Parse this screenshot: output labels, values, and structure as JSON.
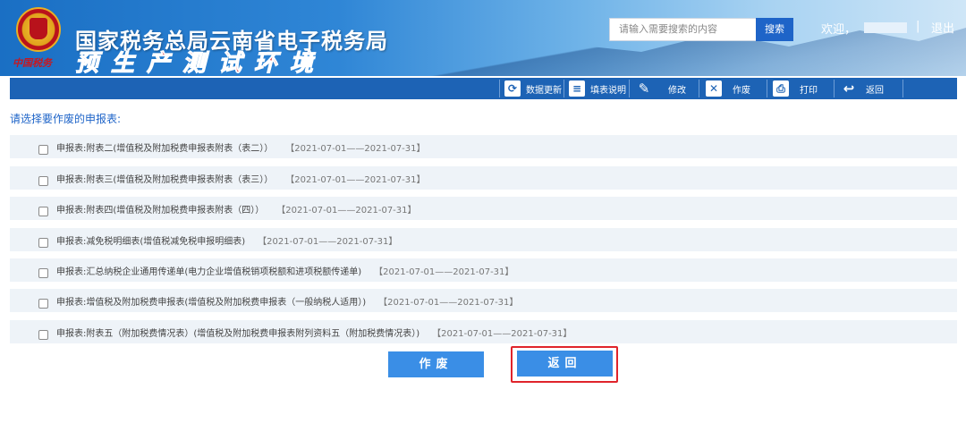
{
  "header": {
    "title": "国家税务总局云南省电子税务局",
    "env_title": "预生产测试环境",
    "emblem_caption": "中国税务",
    "search_placeholder": "请输入需要搜索的内容",
    "search_label": "搜索",
    "welcome": "欢迎，",
    "separator": "|",
    "logout": "退出"
  },
  "toolbar": {
    "items": [
      {
        "label": "数据更新",
        "icon": "data-refresh-icon"
      },
      {
        "label": "填表说明",
        "icon": "instructions-icon"
      },
      {
        "label": "修改",
        "icon": "edit-icon"
      },
      {
        "label": "作废",
        "icon": "void-document-icon"
      },
      {
        "label": "打印",
        "icon": "print-icon"
      },
      {
        "label": "返回",
        "icon": "back-arrow-icon"
      }
    ]
  },
  "main": {
    "prompt": "请选择要作废的申报表:",
    "forms": [
      {
        "name": "申报表:附表二(增值税及附加税费申报表附表（表二））",
        "period": "【2021-07-01——2021-07-31】",
        "checked": false
      },
      {
        "name": "申报表:附表三(增值税及附加税费申报表附表（表三））",
        "period": "【2021-07-01——2021-07-31】",
        "checked": false
      },
      {
        "name": "申报表:附表四(增值税及附加税费申报表附表（四））",
        "period": "【2021-07-01——2021-07-31】",
        "checked": false
      },
      {
        "name": "申报表:减免税明细表(增值税减免税申报明细表)",
        "period": "【2021-07-01——2021-07-31】",
        "checked": false
      },
      {
        "name": "申报表:汇总纳税企业通用传递单(电力企业增值税销项税额和进项税额传递单)",
        "period": "【2021-07-01——2021-07-31】",
        "checked": false
      },
      {
        "name": "申报表:增值税及附加税费申报表(增值税及附加税费申报表（一般纳税人适用）)",
        "period": "【2021-07-01——2021-07-31】",
        "checked": false
      },
      {
        "name": "申报表:附表五（附加税费情况表）(增值税及附加税费申报表附列资料五（附加税费情况表）)",
        "period": "【2021-07-01——2021-07-31】",
        "checked": false
      }
    ],
    "void_button": "作废",
    "return_button": "返回"
  }
}
